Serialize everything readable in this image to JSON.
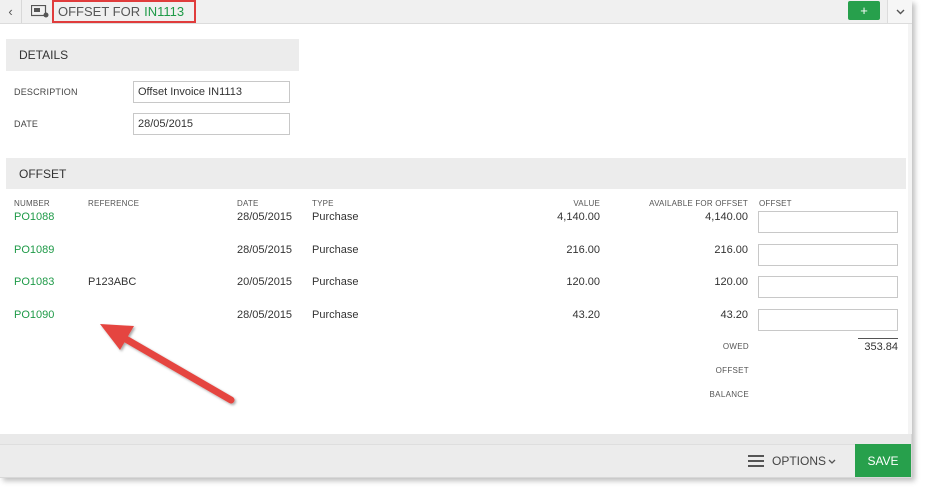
{
  "header": {
    "title_prefix": "OFFSET FOR",
    "title_number": "IN1113",
    "add_label": "+",
    "back_label": "‹",
    "dropdown_label": "⌄"
  },
  "details": {
    "heading": "DETAILS",
    "description_label": "DESCRIPTION",
    "description_value": "Offset Invoice IN1113",
    "date_label": "DATE",
    "date_value": "28/05/2015"
  },
  "offset": {
    "heading": "OFFSET",
    "columns": {
      "number": "NUMBER",
      "reference": "REFERENCE",
      "date": "DATE",
      "type": "TYPE",
      "value": "VALUE",
      "available": "AVAILABLE FOR OFFSET",
      "offset": "OFFSET"
    },
    "rows": [
      {
        "number": "PO1088",
        "reference": "",
        "date": "28/05/2015",
        "type": "Purchase",
        "value": "4,140.00",
        "available": "4,140.00"
      },
      {
        "number": "PO1089",
        "reference": "",
        "date": "28/05/2015",
        "type": "Purchase",
        "value": "216.00",
        "available": "216.00"
      },
      {
        "number": "PO1083",
        "reference": "P123ABC",
        "date": "20/05/2015",
        "type": "Purchase",
        "value": "120.00",
        "available": "120.00"
      },
      {
        "number": "PO1090",
        "reference": "",
        "date": "28/05/2015",
        "type": "Purchase",
        "value": "43.20",
        "available": "43.20"
      }
    ],
    "summary": {
      "owed_label": "OWED",
      "owed_value": "353.84",
      "offset_label": "OFFSET",
      "balance_label": "BALANCE"
    }
  },
  "footer": {
    "options_label": "OPTIONS",
    "save_label": "SAVE"
  },
  "colors": {
    "accent_green": "#27a04c",
    "highlight_red": "#e03c3c",
    "arrow_red": "#e5453f"
  },
  "icons": [
    "back-icon",
    "document-icon",
    "plus-icon",
    "chevron-down-icon",
    "menu-icon",
    "arrow-annotation"
  ]
}
